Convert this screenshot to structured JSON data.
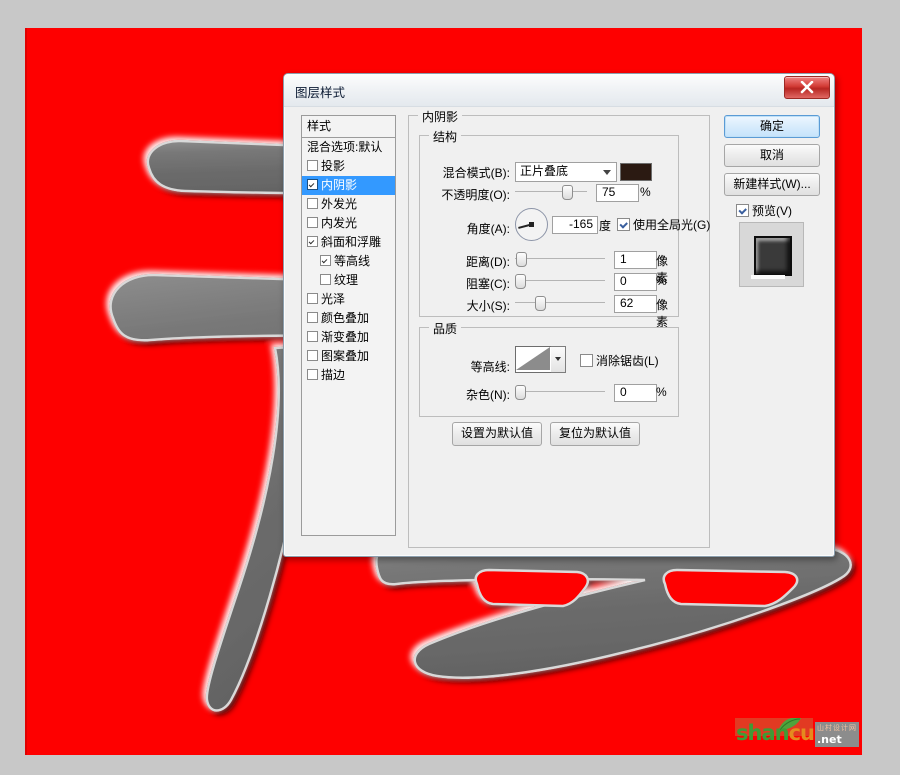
{
  "canvas": {
    "background_color": "#fe0000",
    "artwork_fill": "#6e6e6e",
    "description": "chinese-calligraphy-character"
  },
  "watermark": {
    "brand_part1": "shan",
    "brand_part2": "cun",
    "tag_top": "山村设计网",
    "tag_bottom": ".net"
  },
  "dialog": {
    "title": "图层样式",
    "close_label": "×"
  },
  "styles_panel": {
    "header": "样式",
    "items": [
      {
        "label": "混合选项:默认",
        "checkbox": false,
        "checked": false,
        "selected": false,
        "indent": false
      },
      {
        "label": "投影",
        "checkbox": true,
        "checked": false,
        "selected": false,
        "indent": false
      },
      {
        "label": "内阴影",
        "checkbox": true,
        "checked": true,
        "selected": true,
        "indent": false
      },
      {
        "label": "外发光",
        "checkbox": true,
        "checked": false,
        "selected": false,
        "indent": false
      },
      {
        "label": "内发光",
        "checkbox": true,
        "checked": false,
        "selected": false,
        "indent": false
      },
      {
        "label": "斜面和浮雕",
        "checkbox": true,
        "checked": true,
        "selected": false,
        "indent": false
      },
      {
        "label": "等高线",
        "checkbox": true,
        "checked": true,
        "selected": false,
        "indent": true
      },
      {
        "label": "纹理",
        "checkbox": true,
        "checked": false,
        "selected": false,
        "indent": true
      },
      {
        "label": "光泽",
        "checkbox": true,
        "checked": false,
        "selected": false,
        "indent": false
      },
      {
        "label": "颜色叠加",
        "checkbox": true,
        "checked": false,
        "selected": false,
        "indent": false
      },
      {
        "label": "渐变叠加",
        "checkbox": true,
        "checked": false,
        "selected": false,
        "indent": false
      },
      {
        "label": "图案叠加",
        "checkbox": true,
        "checked": false,
        "selected": false,
        "indent": false
      },
      {
        "label": "描边",
        "checkbox": true,
        "checked": false,
        "selected": false,
        "indent": false
      }
    ]
  },
  "inner_shadow": {
    "legend": "内阴影",
    "structure": {
      "legend": "结构",
      "blend_mode_label": "混合模式(B):",
      "blend_mode_value": "正片叠底",
      "shadow_color": "#2b1a12",
      "opacity_label": "不透明度(O):",
      "opacity_value": "75",
      "opacity_unit": "%",
      "opacity_percent": 75,
      "angle_label": "角度(A):",
      "angle_value": "-165",
      "angle_unit": "度",
      "use_global_light_label": "使用全局光(G)",
      "use_global_light_checked": true,
      "distance_label": "距离(D):",
      "distance_value": "1",
      "distance_unit": "像素",
      "distance_percent": 1,
      "choke_label": "阻塞(C):",
      "choke_value": "0",
      "choke_unit": "%",
      "choke_percent": 0,
      "size_label": "大小(S):",
      "size_value": "62",
      "size_unit": "像素",
      "size_percent": 25
    },
    "quality": {
      "legend": "品质",
      "contour_label": "等高线:",
      "anti_alias_label": "消除锯齿(L)",
      "anti_alias_checked": false,
      "noise_label": "杂色(N):",
      "noise_value": "0",
      "noise_unit": "%",
      "noise_percent": 0
    },
    "buttons": {
      "set_default": "设置为默认值",
      "reset_default": "复位为默认值"
    }
  },
  "right_column": {
    "ok": "确定",
    "cancel": "取消",
    "new_style": "新建样式(W)...",
    "preview_label": "预览(V)",
    "preview_checked": true
  }
}
